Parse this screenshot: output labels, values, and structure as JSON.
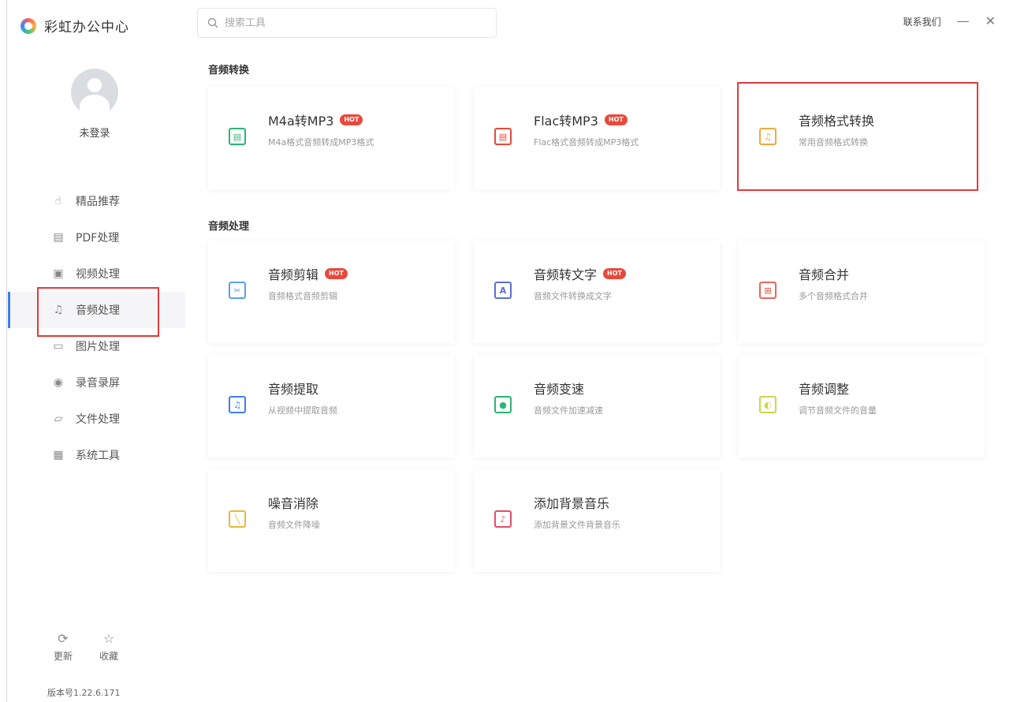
{
  "app": {
    "title": "彩虹办公中心"
  },
  "search": {
    "placeholder": "搜索工具"
  },
  "titlebar": {
    "contact": "联系我们",
    "minimize": "—",
    "close": "✕"
  },
  "user": {
    "status": "未登录"
  },
  "sidebar": {
    "items": [
      {
        "label": "精品推荐",
        "icon": "thumb-up-icon",
        "glyph": "☝"
      },
      {
        "label": "PDF处理",
        "icon": "pdf-icon",
        "glyph": "▤"
      },
      {
        "label": "视频处理",
        "icon": "video-icon",
        "glyph": "▣"
      },
      {
        "label": "音频处理",
        "icon": "music-note-icon",
        "glyph": "♫",
        "active": true
      },
      {
        "label": "图片处理",
        "icon": "image-icon",
        "glyph": "▭"
      },
      {
        "label": "录音录屏",
        "icon": "record-icon",
        "glyph": "◉"
      },
      {
        "label": "文件处理",
        "icon": "folder-icon",
        "glyph": "▱"
      },
      {
        "label": "系统工具",
        "icon": "tools-icon",
        "glyph": "▦"
      }
    ],
    "bottom": {
      "update": "更新",
      "favorite": "收藏",
      "version": "版本号1.22.6.171"
    }
  },
  "sections": {
    "convert": {
      "title": "音频转换",
      "cards": [
        {
          "name": "M4a转MP3",
          "desc": "M4a格式音频转成MP3格式",
          "hot": "HOT",
          "color": "#2bb673",
          "glyph": "▤"
        },
        {
          "name": "Flac转MP3",
          "desc": "Flac格式音频转成MP3格式",
          "hot": "HOT",
          "color": "#e8493b",
          "glyph": "▤"
        },
        {
          "name": "音频格式转换",
          "desc": "常用音频格式转换",
          "color": "#f0a93b",
          "glyph": "♫"
        }
      ]
    },
    "process": {
      "title": "音频处理",
      "cards": [
        {
          "name": "音频剪辑",
          "desc": "音频格式音频剪辑",
          "hot": "HOT",
          "color": "#5aa0f0",
          "glyph": "✂"
        },
        {
          "name": "音频转文字",
          "desc": "音频文件转换成文字",
          "hot": "HOT",
          "color": "#5a6fd8",
          "glyph": "A"
        },
        {
          "name": "音频合并",
          "desc": "多个音频格式合并",
          "color": "#e8685a",
          "glyph": "⊞"
        },
        {
          "name": "音频提取",
          "desc": "从视频中提取音频",
          "color": "#3b7ff5",
          "glyph": "♫"
        },
        {
          "name": "音频变速",
          "desc": "音频文件加速减速",
          "color": "#2bb673",
          "glyph": "●"
        },
        {
          "name": "音频调整",
          "desc": "调节音频文件的音量",
          "color": "#c8d84b",
          "glyph": "◐"
        },
        {
          "name": "噪音消除",
          "desc": "音频文件降噪",
          "color": "#e8b83b",
          "glyph": "╲"
        },
        {
          "name": "添加背景音乐",
          "desc": "添加背景文件背景音乐",
          "color": "#e84b6a",
          "glyph": "♪"
        }
      ]
    }
  }
}
